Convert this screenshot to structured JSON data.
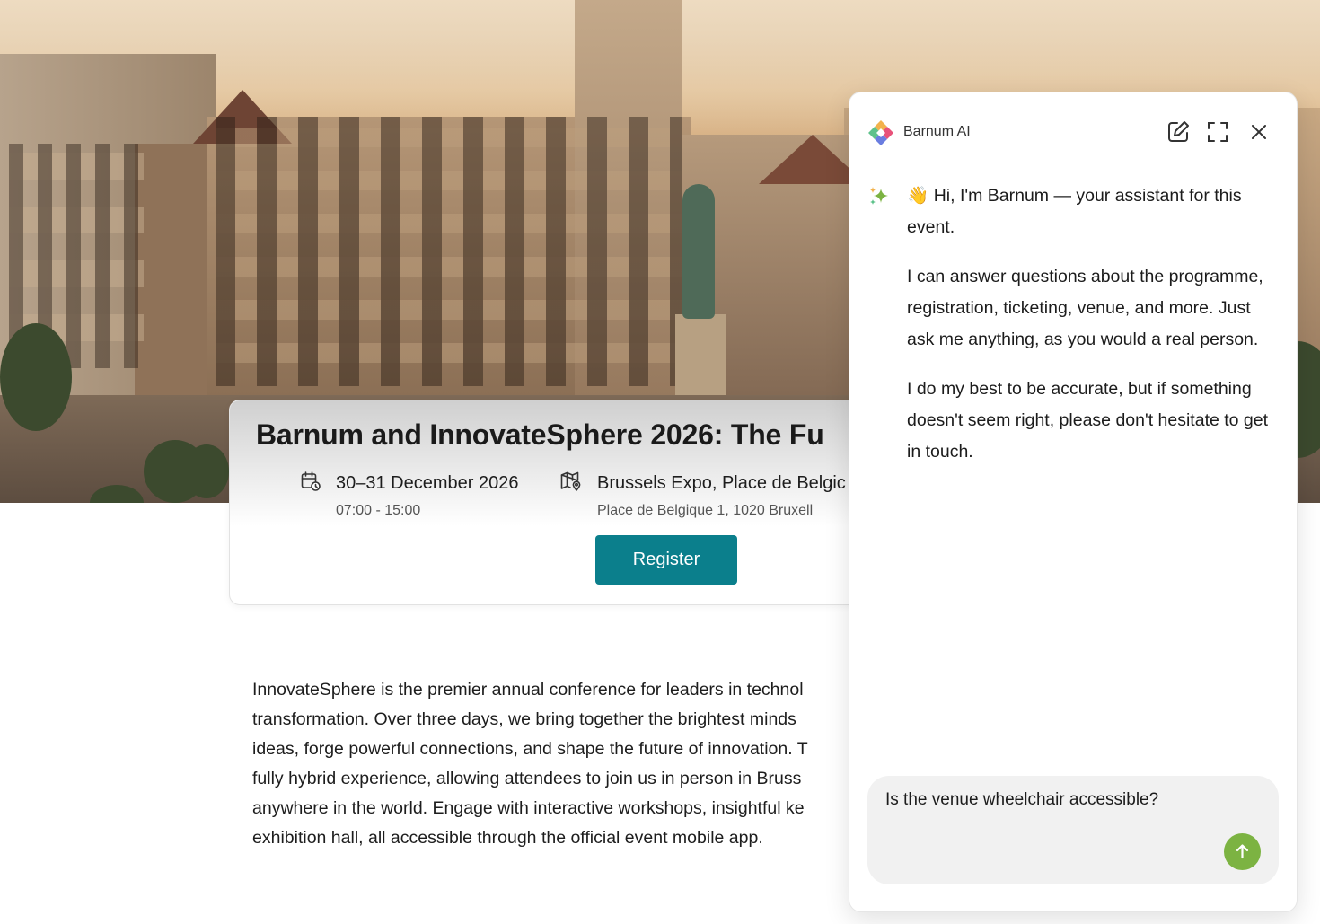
{
  "event": {
    "title": "Barnum and InnovateSphere 2026: The Fu",
    "date": "30–31 December 2026",
    "time": "07:00 - 15:00",
    "venue": "Brussels Expo, Place de Belgic",
    "address": "Place de Belgique 1, 1020 Bruxell",
    "register_label": "Register"
  },
  "description": [
    "InnovateSphere is the premier annual conference for leaders in technol",
    "transformation. Over three days, we bring together the brightest minds",
    "ideas, forge powerful connections, and shape the future of innovation. T",
    "fully hybrid experience, allowing attendees to join us in person in Bruss",
    "anywhere in the world. Engage with interactive workshops, insightful ke",
    "exhibition hall, all accessible through the official event mobile app."
  ],
  "chat": {
    "brand": "Barnum AI",
    "messages": [
      "👋 Hi, I'm Barnum — your assistant for this event.",
      "I can answer questions about the programme, registration, ticketing, venue, and more. Just ask me anything, as you would a real person.",
      "I do my best to be accurate, but if something doesn't seem right, please don't hesitate to get in touch."
    ],
    "input_value": "Is the venue wheelchair accessible?"
  },
  "colors": {
    "register_button": "#0b7f8c",
    "send_button": "#7cb342"
  },
  "icons": {
    "date": "calendar-clock-icon",
    "venue": "map-pin-icon",
    "logo": "barnum-logo-icon",
    "new_chat": "edit-icon",
    "expand": "expand-icon",
    "close": "close-icon",
    "assistant": "sparkle-icon",
    "send": "arrow-up-icon"
  }
}
